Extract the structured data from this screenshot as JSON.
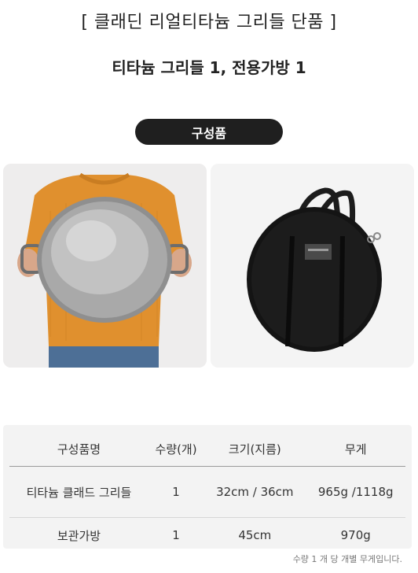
{
  "header": {
    "title": "[ 클래딘 리얼티타늄 그리들 단품 ]",
    "subtitle": "티타늄 그리들 1, 전용가방 1"
  },
  "badge": {
    "label": "구성품"
  },
  "images": {
    "left_alt": "티타늄 그리들을 들고 있는 사람",
    "right_alt": "그리들 전용가방"
  },
  "table": {
    "headers": [
      "구성품명",
      "수량(개)",
      "크기(지름)",
      "무게"
    ],
    "rows": [
      [
        "티타늄 클래드 그리들",
        "1",
        "32cm / 36cm",
        "965g /1118g"
      ],
      [
        "보관가방",
        "1",
        "45cm",
        "970g"
      ]
    ]
  },
  "note": "수량 1 개 당 개별 무게입니다.",
  "colors": {
    "badge_bg": "#1f1f1f",
    "table_bg": "#f3f3f3"
  }
}
